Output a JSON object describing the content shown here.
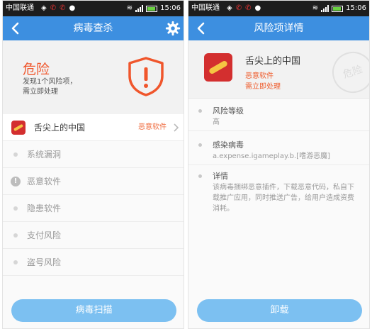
{
  "status_bar": {
    "carrier": "中国联通",
    "time": "15:06"
  },
  "scan_screen": {
    "title": "病毒查杀",
    "status_title": "危险",
    "status_desc_line1": "发现1个风险项，",
    "status_desc_line2": "需立即处理",
    "risk_app": {
      "name": "舌尖上的中国",
      "tag": "恶意软件"
    },
    "categories": [
      "系统漏洞",
      "恶意软件",
      "隐患软件",
      "支付风险",
      "盗号风险"
    ],
    "button_label": "病毒扫描"
  },
  "detail_screen": {
    "title": "风险项详情",
    "app_name": "舌尖上的中国",
    "app_tag": "恶意软件",
    "app_action": "需立即处理",
    "stamp_text": "危险",
    "sections": [
      {
        "title": "风险等级",
        "value": "高"
      },
      {
        "title": "感染病毒",
        "value": "a.expense.igameplay.b.[嗜游恶魔]"
      },
      {
        "title": "详情",
        "value": "该病毒捆绑恶意插件，下载恶意代码，私自下载推广应用，同时推送广告，给用户造成资费消耗。"
      }
    ],
    "button_label": "卸载"
  },
  "colors": {
    "accent": "#3d8fe0",
    "danger": "#f0562c",
    "button": "#7cc0f1"
  }
}
